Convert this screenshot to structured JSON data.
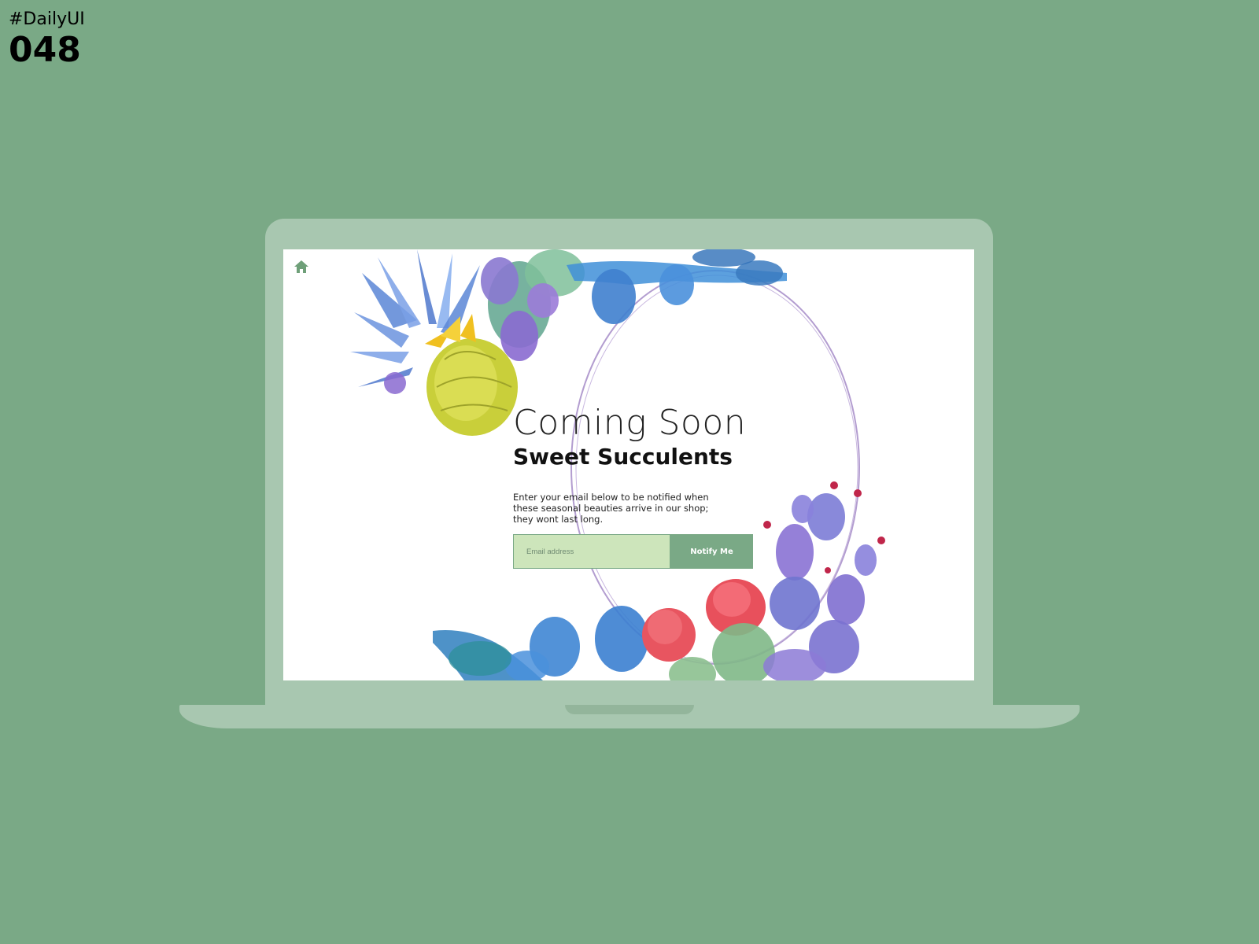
{
  "overlay": {
    "hashtag": "#DailyUI",
    "day_number": "048"
  },
  "page": {
    "headline": "Coming Soon",
    "brand": "Sweet Succulents",
    "description": "Enter your email below to be notified when these seasonal beauties arrive in our shop; they wont last long.",
    "email_placeholder": "Email address",
    "email_value": "",
    "notify_label": "Notify Me"
  },
  "icons": {
    "home": "home-icon"
  },
  "colors": {
    "background": "#7aa986",
    "laptop": "#a8c7b0",
    "accent": "#7aa986",
    "input_bg": "#cde5bb",
    "ring": "#b39dd0"
  }
}
